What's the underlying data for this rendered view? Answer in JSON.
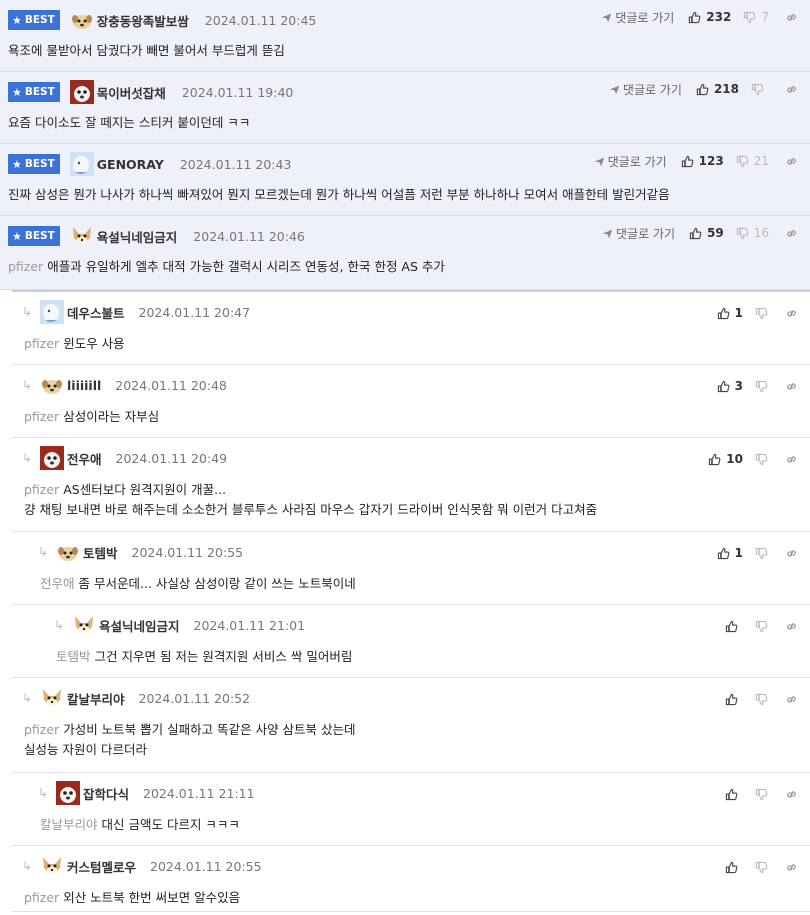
{
  "labels": {
    "best": "BEST",
    "goto": "댓글로 가기"
  },
  "colors": {
    "best_badge": "#3a72d8",
    "best_background": "#eef1f9",
    "mention": "#999999"
  },
  "best_comments": [
    {
      "nick": "장충동왕족발보쌈",
      "date": "2024.01.11 20:45",
      "likes": "232",
      "dislikes": "7",
      "mention": "",
      "text": "욕조에 물받아서 담궜다가 빼면 불어서 부드럽게 뜯김"
    },
    {
      "nick": "목이버섯잡채",
      "date": "2024.01.11 19:40",
      "likes": "218",
      "dislikes": "",
      "mention": "",
      "text": "요즘 다이소도 잘 떼지는 스티커 붙이던데 ㅋㅋ"
    },
    {
      "nick": "GENORAY",
      "date": "2024.01.11 20:43",
      "likes": "123",
      "dislikes": "21",
      "mention": "",
      "text": "진짜 삼성은 뭔가 나사가 하나씩 빠져있어 뭔지 모르겠는데 뭔가 하나씩 어설픔 저런 부분 하나하나 모여서 애플한테 발린거같음"
    },
    {
      "nick": "욕설닉네임금지",
      "date": "2024.01.11 20:46",
      "likes": "59",
      "dislikes": "16",
      "mention": "pfizer",
      "text": "애플과 유일하게 엘추 대적 가능한 갤럭시 시리즈 연동성, 한국 한정 AS 추가"
    }
  ],
  "replies": [
    {
      "nick": "데우스불트",
      "date": "2024.01.11 20:47",
      "likes": "1",
      "dislikes": "",
      "mention": "pfizer",
      "lines": [
        "윈도우 사용"
      ]
    },
    {
      "nick": "liiiiill",
      "date": "2024.01.11 20:48",
      "likes": "3",
      "dislikes": "",
      "mention": "pfizer",
      "lines": [
        "삼성이라는 자부심"
      ]
    },
    {
      "nick": "전우애",
      "date": "2024.01.11 20:49",
      "likes": "10",
      "dislikes": "",
      "mention": "pfizer",
      "lines": [
        "AS센터보다 원격지원이 개꿀...",
        "걍 채팅 보내면 바로 해주는데 소소한거 블루투스 사라짐 마우스 갑자기 드라이버 인식못함 뭐 이런거 다고쳐줌"
      ]
    },
    {
      "nick": "토템박",
      "date": "2024.01.11 20:55",
      "likes": "1",
      "dislikes": "",
      "mention": "전우애",
      "lines": [
        "좀 무서운데... 사실상 삼성이랑 같이 쓰는 노트북이네"
      ]
    },
    {
      "nick": "욕설닉네임금지",
      "date": "2024.01.11 21:01",
      "likes": "",
      "dislikes": "",
      "mention": "토템박",
      "lines": [
        "그건 지우면 됨 저는 원격지원 서비스 싹 밀어버림"
      ]
    },
    {
      "nick": "칼날부리야",
      "date": "2024.01.11 20:52",
      "likes": "",
      "dislikes": "",
      "mention": "pfizer",
      "lines": [
        "가성비 노트북 뽑기 실패하고 똑같은 사양 삼트북 샀는데",
        "실성능 자원이 다르더라"
      ]
    },
    {
      "nick": "잡학다식",
      "date": "2024.01.11 21:11",
      "likes": "",
      "dislikes": "",
      "mention": "칼날부리야",
      "lines": [
        "대신 금액도 다르지 ㅋㅋㅋ"
      ]
    },
    {
      "nick": "커스텀멜로우",
      "date": "2024.01.11 20:55",
      "likes": "",
      "dislikes": "",
      "mention": "pfizer",
      "lines": [
        "외산 노트북 한번 써보면 알수있음"
      ]
    }
  ]
}
